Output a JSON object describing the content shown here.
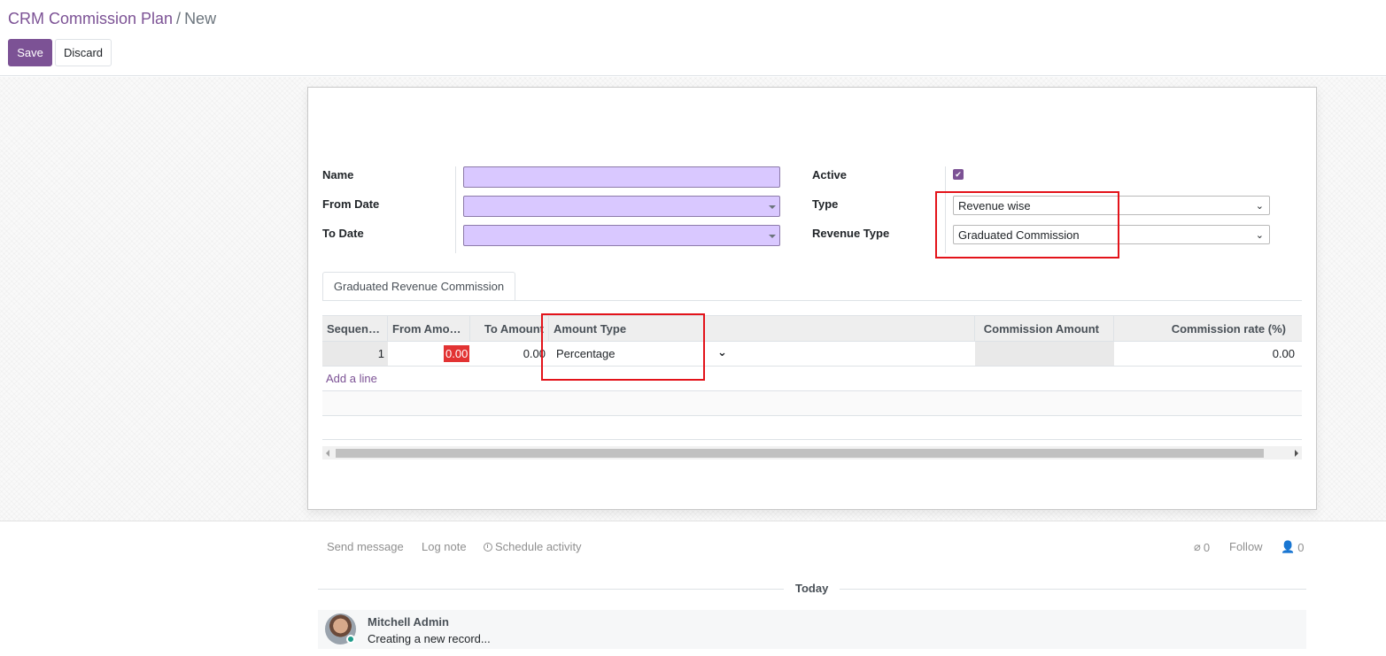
{
  "breadcrumb": {
    "parent": "CRM Commission Plan",
    "separator": "/",
    "current": "New"
  },
  "buttons": {
    "save": "Save",
    "discard": "Discard"
  },
  "form": {
    "left_fields": [
      {
        "label": "Name",
        "value": ""
      },
      {
        "label": "From Date",
        "value": ""
      },
      {
        "label": "To Date",
        "value": ""
      }
    ],
    "right_fields": {
      "active_label": "Active",
      "active_checked": true,
      "type_label": "Type",
      "type_value": "Revenue wise",
      "revenue_type_label": "Revenue Type",
      "revenue_type_value": "Graduated Commission"
    }
  },
  "tabs": [
    {
      "label": "Graduated Revenue Commission"
    }
  ],
  "table": {
    "headers": [
      "Sequen…",
      "From Amo…",
      "To Amount",
      "Amount Type",
      "Commission Amount",
      "Commission rate (%)"
    ],
    "rows": [
      {
        "sequence": "1",
        "from_amount": "0.00",
        "to_amount": "0.00",
        "amount_type": "Percentage",
        "commission_amount": "",
        "commission_rate": "0.00"
      }
    ],
    "add_line": "Add a line"
  },
  "chatter": {
    "send_message": "Send message",
    "log_note": "Log note",
    "schedule_activity": "Schedule activity",
    "attachments_count": "0",
    "follow": "Follow",
    "followers_count": "0",
    "date_separator": "Today",
    "messages": [
      {
        "author": "Mitchell Admin",
        "body": "Creating a new record..."
      }
    ]
  },
  "colors": {
    "primary": "#7c5295",
    "required_field": "#d9c8ff",
    "invalid_cell": "#e23333",
    "highlight_box": "#e3131a"
  },
  "icons": [
    "chevron-down-icon",
    "checkbox-checked-icon",
    "clock-icon",
    "paperclip-icon",
    "user-icon"
  ]
}
